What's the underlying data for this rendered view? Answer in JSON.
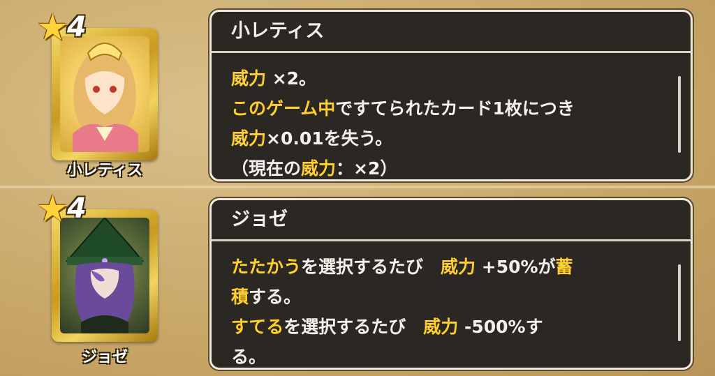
{
  "skills": [
    {
      "rank": "4",
      "card_name": "小レティス",
      "panel_title": "小レティス",
      "lines": [
        [
          {
            "t": "威力",
            "hl": true
          },
          {
            "t": " ×2。",
            "hl": false
          }
        ],
        [
          {
            "t": "このゲーム中",
            "hl": true
          },
          {
            "t": "ですてられたカード1枚につき",
            "hl": false
          }
        ],
        [
          {
            "t": "威力",
            "hl": true
          },
          {
            "t": "×0.01を失う。",
            "hl": false
          }
        ],
        [
          {
            "t": "（現在の",
            "hl": false
          },
          {
            "t": "威力",
            "hl": true
          },
          {
            "t": "：×2）",
            "hl": false
          }
        ]
      ]
    },
    {
      "rank": "4",
      "card_name": "ジョゼ",
      "panel_title": "ジョゼ",
      "lines": [
        [
          {
            "t": "たたかう",
            "hl": true
          },
          {
            "t": "を選択するたび　",
            "hl": false
          },
          {
            "t": "威力",
            "hl": true
          },
          {
            "t": " +50%が",
            "hl": false
          },
          {
            "t": "蓄",
            "hl": true
          }
        ],
        [
          {
            "t": "積",
            "hl": true
          },
          {
            "t": "する。",
            "hl": false
          }
        ],
        [
          {
            "t": "すてる",
            "hl": true
          },
          {
            "t": "を選択するたび　",
            "hl": false
          },
          {
            "t": "威力",
            "hl": true
          },
          {
            "t": " -500%す",
            "hl": false
          }
        ],
        [
          {
            "t": "る。",
            "hl": false
          }
        ]
      ]
    }
  ],
  "colors": {
    "highlight": "#ffcf2e",
    "text": "#f4f1ea",
    "panel_bg": "#2b2722",
    "star": "#ffd43a"
  },
  "icons": {
    "rank": "star-icon"
  }
}
